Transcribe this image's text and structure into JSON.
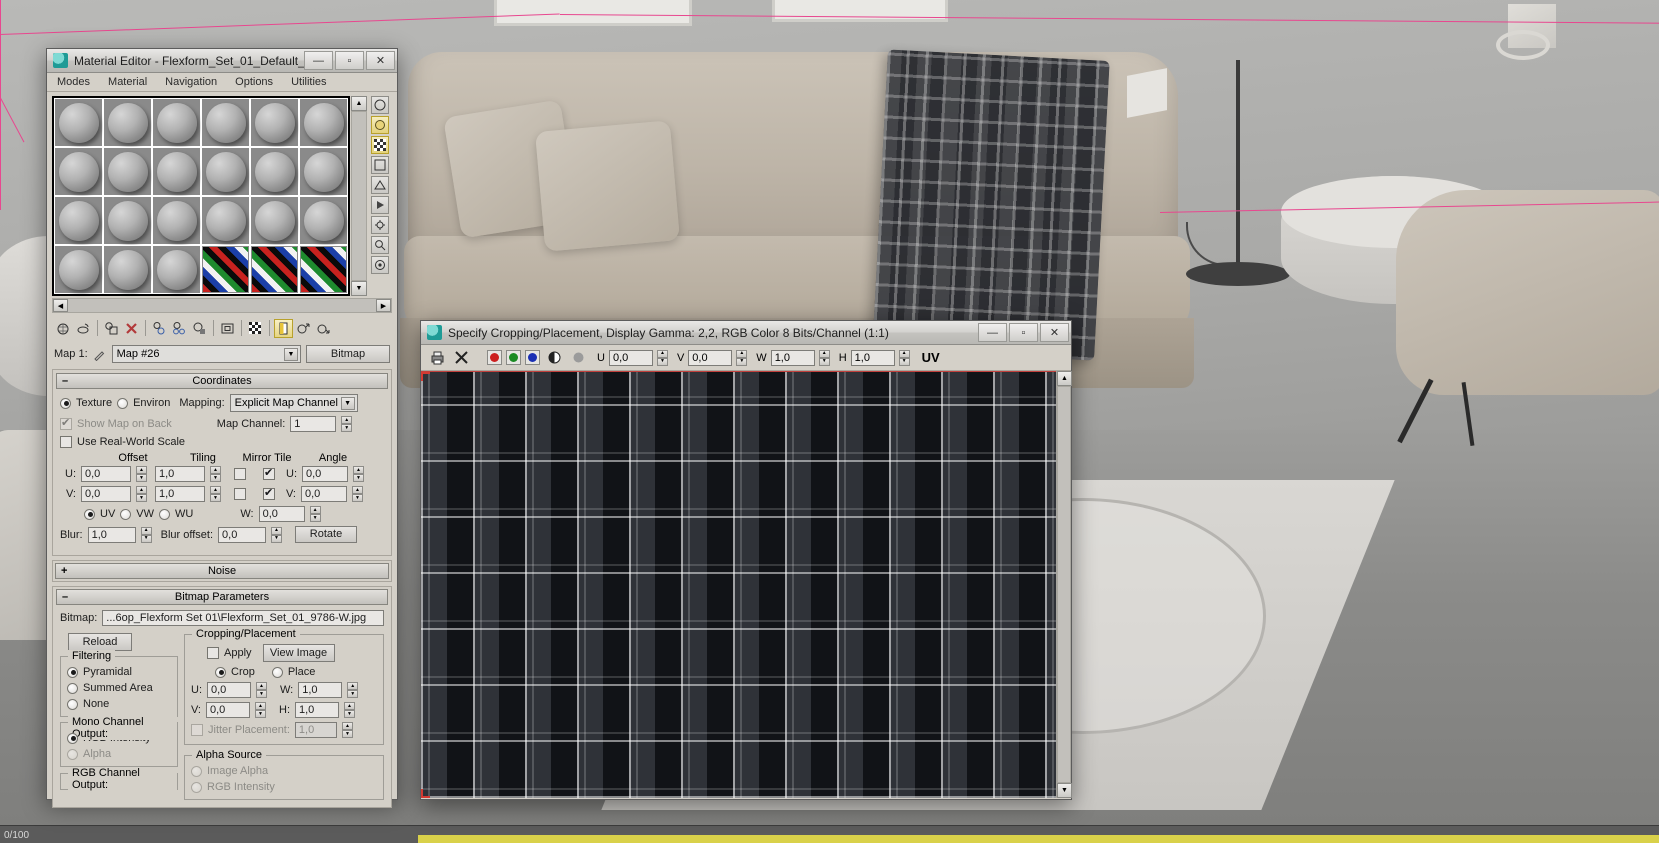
{
  "viewport": {
    "status_left": "0/100"
  },
  "material_editor": {
    "title": "Material Editor - Flexform_Set_01_Default_...",
    "window_buttons": {
      "minimize": "—",
      "maximize": "▫",
      "close": "✕"
    },
    "menus": [
      "Modes",
      "Material",
      "Navigation",
      "Options",
      "Utilities"
    ],
    "slots": [
      {
        "type": "sphere"
      },
      {
        "type": "sphere"
      },
      {
        "type": "sphere"
      },
      {
        "type": "sphere"
      },
      {
        "type": "sphere"
      },
      {
        "type": "sphere"
      },
      {
        "type": "sphere"
      },
      {
        "type": "sphere"
      },
      {
        "type": "sphere"
      },
      {
        "type": "sphere"
      },
      {
        "type": "sphere"
      },
      {
        "type": "sphere"
      },
      {
        "type": "sphere"
      },
      {
        "type": "sphere"
      },
      {
        "type": "sphere"
      },
      {
        "type": "sphere"
      },
      {
        "type": "sphere"
      },
      {
        "type": "sphere"
      },
      {
        "type": "sphere"
      },
      {
        "type": "sphere"
      },
      {
        "type": "sphere"
      },
      {
        "type": "checker"
      },
      {
        "type": "checker"
      },
      {
        "type": "checker"
      }
    ],
    "vertical_tools": [
      "sample-type-sphere-icon",
      "backlight-icon",
      "background-checker-icon",
      "sample-uv-tiling-icon",
      "video-color-check-icon",
      "make-preview-icon",
      "options-icon",
      "select-by-material-icon",
      "material-id-channel-icon"
    ],
    "toolbar": [
      "get-material-icon",
      "put-material-to-scene-icon",
      "assign-material-to-selection-icon",
      "reset-map-icon",
      "make-material-copy-icon",
      "make-unique-icon",
      "put-to-library-icon",
      "material-effects-channel-icon",
      "show-shaded-material-in-viewport-icon",
      "show-end-result-icon",
      "go-to-parent-icon",
      "go-forward-to-sibling-icon"
    ],
    "map_row": {
      "label": "Map 1:",
      "pin_icon": "eyedropper-icon",
      "map_name": "Map #26",
      "type_button": "Bitmap"
    },
    "coordinates": {
      "header": "Coordinates",
      "expanded_glyph": "–",
      "texture_label": "Texture",
      "texture_selected": true,
      "environ_label": "Environ",
      "environ_selected": false,
      "mapping_label": "Mapping:",
      "mapping_value": "Explicit Map Channel",
      "show_map_on_back_label": "Show Map on Back",
      "show_map_on_back_checked": true,
      "map_channel_label": "Map Channel:",
      "map_channel_value": "1",
      "use_real_world_scale_label": "Use Real-World Scale",
      "use_real_world_scale_checked": false,
      "col_offset": "Offset",
      "col_tiling": "Tiling",
      "col_mirror_tile": "Mirror Tile",
      "col_angle": "Angle",
      "u_label": "U:",
      "v_label": "V:",
      "w_label": "W:",
      "offset_u": "0,0",
      "offset_v": "0,0",
      "tiling_u": "1,0",
      "tiling_v": "1,0",
      "mirror_u": false,
      "mirror_v": false,
      "tile_u": true,
      "tile_v": true,
      "angle_u": "0,0",
      "angle_v": "0,0",
      "angle_w": "0,0",
      "uvw_options": [
        "UV",
        "VW",
        "WU"
      ],
      "uvw_selected": "UV",
      "blur_label": "Blur:",
      "blur_value": "1,0",
      "blur_offset_label": "Blur offset:",
      "blur_offset_value": "0,0",
      "rotate_button": "Rotate"
    },
    "noise": {
      "header": "Noise",
      "collapsed_glyph": "+"
    },
    "bitmap_parameters": {
      "header": "Bitmap Parameters",
      "expanded_glyph": "–",
      "bitmap_label": "Bitmap:",
      "bitmap_path": "...6op_Flexform Set 01\\Flexform_Set_01_9786-W.jpg",
      "reload_button": "Reload",
      "filtering": {
        "title": "Filtering",
        "options": [
          "Pyramidal",
          "Summed Area",
          "None"
        ],
        "selected": "Pyramidal"
      },
      "mono_channel_output": {
        "title": "Mono Channel Output:",
        "options": [
          "RGB Intensity",
          "Alpha"
        ],
        "selected": "RGB Intensity"
      },
      "rgb_channel_output": {
        "title": "RGB Channel Output:"
      },
      "cropping_placement": {
        "title": "Cropping/Placement",
        "apply_label": "Apply",
        "apply_checked": false,
        "view_image_button": "View Image",
        "crop_label": "Crop",
        "place_label": "Place",
        "mode_selected": "Crop",
        "u_label": "U:",
        "u_value": "0,0",
        "v_label": "V:",
        "v_value": "0,0",
        "w_label": "W:",
        "w_value": "1,0",
        "h_label": "H:",
        "h_value": "1,0",
        "jitter_label": "Jitter Placement:",
        "jitter_value": "1,0",
        "jitter_enabled": false
      },
      "alpha_source": {
        "title": "Alpha Source",
        "options": [
          "Image Alpha",
          "RGB Intensity"
        ]
      }
    }
  },
  "crop_window": {
    "title": "Specify Cropping/Placement, Display Gamma: 2,2, RGB Color 8 Bits/Channel (1:1)",
    "window_buttons": {
      "minimize": "—",
      "maximize": "▫",
      "close": "✕"
    },
    "toolbar": {
      "print_icon": "printer-icon",
      "close_icon": "x-icon",
      "channels": [
        {
          "name": "red-channel-toggle",
          "color": "#cc1f1f"
        },
        {
          "name": "green-channel-toggle",
          "color": "#1a8a22"
        },
        {
          "name": "blue-channel-toggle",
          "color": "#1a2fb4"
        }
      ],
      "mono_icon": "half-circle-icon",
      "alpha_icon": "gray-circle-icon",
      "u_label": "U",
      "u_value": "0,0",
      "v_label": "V",
      "v_value": "0,0",
      "w_label": "W",
      "w_value": "1,0",
      "h_label": "H",
      "h_value": "1,0",
      "mode_label": "UV"
    }
  }
}
